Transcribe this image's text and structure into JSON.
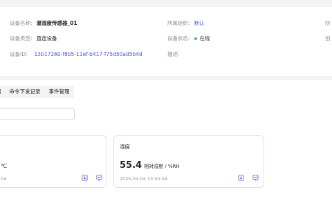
{
  "device_info": {
    "name_label": "设备名称:",
    "name_value": "温湿度传感器_01",
    "type_label": "设备类型:",
    "type_value": "直连设备",
    "id_label": "设备ID:",
    "id_value": "13b17260-f8b5-11ef-b417-f75d50ad5b4d",
    "org_label": "所属组织:",
    "org_value": "默认",
    "status_label": "设备状态:",
    "status_value": "在线",
    "desc_label": "描述:",
    "right_col_top": "所",
    "right_col_mid": "创"
  },
  "tabs": [
    {
      "label": "据"
    },
    {
      "label": "命令下发记录"
    },
    {
      "label": "事件管理"
    }
  ],
  "cards": [
    {
      "title": "",
      "value": "",
      "unit": "℃",
      "time": "04"
    },
    {
      "title": "湿度",
      "value": "55.4",
      "unit": "相对湿度 / %RH",
      "time": "2025-03-04 13:00:04"
    }
  ],
  "colors": {
    "accent": "#4a5cd6",
    "online": "#3bc48a",
    "icon": "#4a5cd6"
  }
}
